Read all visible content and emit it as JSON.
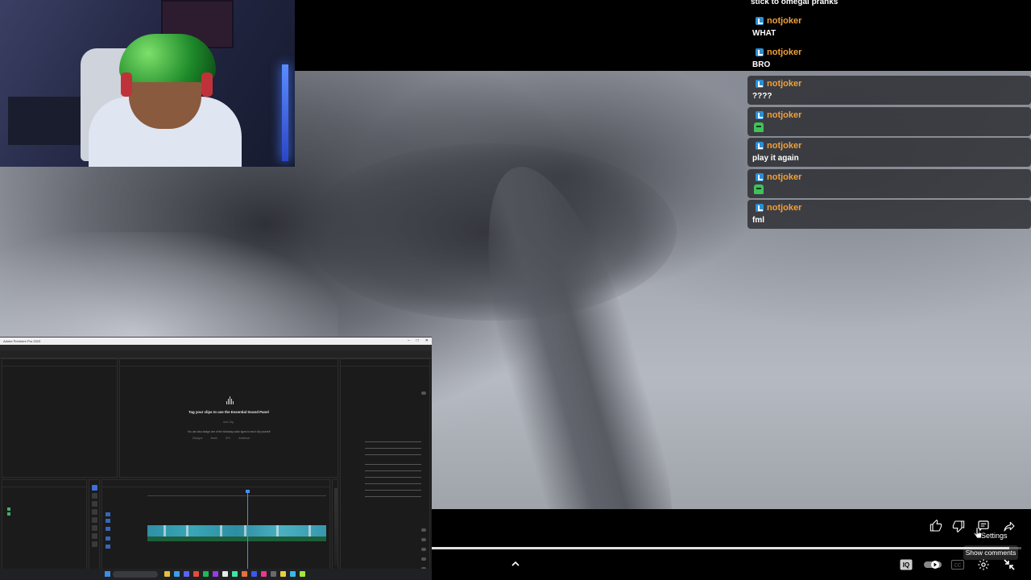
{
  "chat": {
    "top_text": "stick to omegal pranks",
    "messages": [
      {
        "user": "notjoker",
        "text": "WHAT",
        "emote": false
      },
      {
        "user": "notjoker",
        "text": "BRO",
        "emote": false
      },
      {
        "user": "notjoker",
        "text": "????",
        "emote": false
      },
      {
        "user": "notjoker",
        "text": "",
        "emote": true
      },
      {
        "user": "notjoker",
        "text": "play it again",
        "emote": false
      },
      {
        "user": "notjoker",
        "text": "",
        "emote": true
      },
      {
        "user": "notjoker",
        "text": "fml",
        "emote": false
      }
    ]
  },
  "premiere": {
    "essential_sound": {
      "title": "Tag your clips to use the Essential Sound Panel",
      "subtitle": "You can also assign one of the following audio types to each clip yourself",
      "auto_tag": "Auto-Tag",
      "types": [
        "Dialogue",
        "Music",
        "SFX",
        "Ambience"
      ]
    },
    "window_title": "Adobe Premiere Pro 2023"
  },
  "player": {
    "tooltip": "Show comments",
    "settings_label": "Settings",
    "progress": 0.98
  },
  "colors": {
    "username": "#f0a13a",
    "badge": "#2b8fd6",
    "emote": "#3fc25a"
  },
  "icons": {
    "like": "thumbs-up-icon",
    "dislike": "thumbs-down-icon",
    "comments": "comment-icon",
    "share": "share-icon",
    "settings": "gear-icon",
    "captions": "cc-icon",
    "autoplay": "autoplay-toggle-icon",
    "expand": "chevron-up-icon"
  }
}
